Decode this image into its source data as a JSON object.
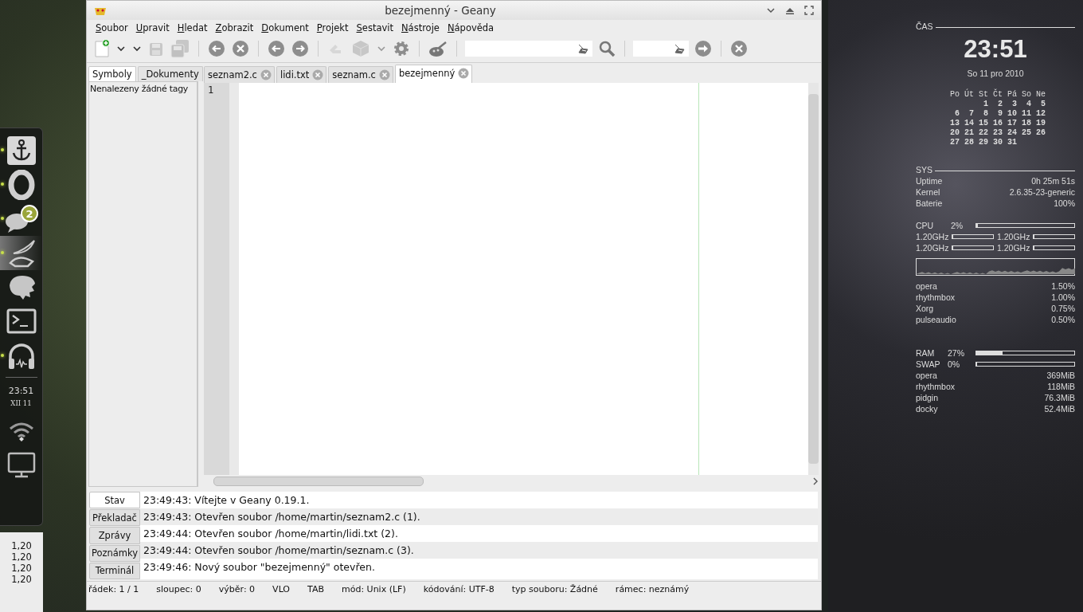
{
  "window": {
    "title": "bezejmenný - Geany"
  },
  "menu": [
    "Soubor",
    "Upravit",
    "Hledat",
    "Zobrazit",
    "Dokument",
    "Projekt",
    "Sestavit",
    "Nástroje",
    "Nápověda"
  ],
  "toolbar": [
    {
      "kind": "new",
      "disabled": false
    },
    {
      "kind": "caret",
      "disabled": false
    },
    {
      "kind": "caret",
      "disabled": false
    },
    {
      "kind": "save",
      "disabled": true
    },
    {
      "kind": "save-all",
      "disabled": true
    },
    {
      "kind": "sep"
    },
    {
      "kind": "revert",
      "disabled": false
    },
    {
      "kind": "close",
      "disabled": false
    },
    {
      "kind": "sep"
    },
    {
      "kind": "back",
      "disabled": false
    },
    {
      "kind": "forward",
      "disabled": false
    },
    {
      "kind": "sep"
    },
    {
      "kind": "compile",
      "disabled": true
    },
    {
      "kind": "build",
      "disabled": true
    },
    {
      "kind": "caret",
      "disabled": true
    },
    {
      "kind": "gear",
      "disabled": false
    },
    {
      "kind": "sep"
    },
    {
      "kind": "palette",
      "disabled": false
    },
    {
      "kind": "sep"
    },
    {
      "kind": "search-field"
    },
    {
      "kind": "search",
      "disabled": false
    },
    {
      "kind": "sep"
    },
    {
      "kind": "line-field"
    },
    {
      "kind": "jump",
      "disabled": false
    },
    {
      "kind": "sep"
    },
    {
      "kind": "quit",
      "disabled": false
    }
  ],
  "sidebar_tabs": [
    {
      "label": "Symboly",
      "selected": true
    },
    {
      "label": "_Dokumenty",
      "selected": false
    }
  ],
  "sidebar": {
    "message": "Nenalezeny žádné tagy"
  },
  "editor_tabs": [
    {
      "label": "seznam2.c",
      "selected": false
    },
    {
      "label": "lidi.txt",
      "selected": false
    },
    {
      "label": "seznam.c",
      "selected": false
    },
    {
      "label": "bezejmenný",
      "selected": true
    }
  ],
  "editor": {
    "line_numbers": [
      "1"
    ]
  },
  "message_tabs": [
    {
      "label": "Stav",
      "selected": true
    },
    {
      "label": "Překladač",
      "selected": false
    },
    {
      "label": "Zprávy",
      "selected": false
    },
    {
      "label": "Poznámky",
      "selected": false
    },
    {
      "label": "Terminál",
      "selected": false
    }
  ],
  "messages": [
    "23:49:43: Vítejte v Geany 0.19.1.",
    "23:49:43: Otevřen soubor /home/martin/seznam2.c (1).",
    "23:49:44: Otevřen soubor /home/martin/lidi.txt (2).",
    "23:49:44: Otevřen soubor /home/martin/seznam.c (3).",
    "23:49:46: Nový soubor \"bezejmenný\" otevřen."
  ],
  "status_bar": [
    "řádek: 1 / 1",
    "sloupec: 0",
    "výběr: 0",
    "VLO",
    "TAB",
    "mód: Unix (LF)",
    "kódování: UTF-8",
    "typ souboru: Žádné",
    "rámec: neznámý"
  ],
  "dock": {
    "items": [
      {
        "kind": "anchor",
        "running": true,
        "selected": false
      },
      {
        "kind": "letter-o",
        "running": true,
        "selected": false
      },
      {
        "kind": "chat",
        "running": true,
        "selected": false,
        "badge": "2"
      },
      {
        "kind": "lamp",
        "running": true,
        "selected": true
      },
      {
        "kind": "blob",
        "running": false,
        "selected": false
      },
      {
        "kind": "terminal",
        "running": false,
        "selected": false
      },
      {
        "kind": "headphones",
        "running": true,
        "selected": false
      }
    ],
    "clock_time": "23:51",
    "clock_date": "XII 11",
    "tray": [
      {
        "kind": "wifi"
      },
      {
        "kind": "monitor"
      }
    ]
  },
  "side_panel": [
    "1,20",
    "1,20",
    "1,20",
    "1,20"
  ],
  "conky": {
    "time_heading": "ČAS",
    "time": "23:51",
    "date": "So 11 pro 2010",
    "calendar": {
      "weekdays": [
        "Po",
        "Út",
        "St",
        "Čt",
        "Pá",
        "So",
        "Ne"
      ],
      "weeks": [
        [
          "1",
          "2",
          "3",
          "4",
          "5"
        ],
        [
          "6",
          "7",
          "8",
          "9",
          "10",
          "11",
          "12"
        ],
        [
          "13",
          "14",
          "15",
          "16",
          "17",
          "18",
          "19"
        ],
        [
          "20",
          "21",
          "22",
          "23",
          "24",
          "25",
          "26"
        ],
        [
          "27",
          "28",
          "29",
          "30",
          "31"
        ]
      ]
    },
    "sys_heading": "SYS",
    "sys": [
      {
        "label": "Uptime",
        "value": "0h 25m 51s"
      },
      {
        "label": "Kernel",
        "value": "2.6.35-23-generic"
      },
      {
        "label": "Baterie",
        "value": "100%"
      }
    ],
    "cpu": {
      "label": "CPU",
      "reading": "2%",
      "level": 0.02
    },
    "cores": [
      {
        "reading": "1.20GHz",
        "level": 0
      },
      {
        "reading": "1.20GHz",
        "level": 0
      },
      {
        "reading": "1.20GHz",
        "level": 0
      },
      {
        "reading": "1.20GHz",
        "level": 0
      }
    ],
    "cpu_processes": [
      {
        "name": "opera",
        "value": "1.50%"
      },
      {
        "name": "rhythmbox",
        "value": "1.00%"
      },
      {
        "name": "Xorg",
        "value": "0.75%"
      },
      {
        "name": "pulseaudio",
        "value": "0.50%"
      }
    ],
    "memory": [
      {
        "label": "RAM",
        "reading": "27%",
        "level": 0.27
      },
      {
        "label": "SWAP",
        "reading": "0%",
        "level": 0
      }
    ],
    "mem_processes": [
      {
        "name": "opera",
        "value": "369MiB"
      },
      {
        "name": "rhythmbox",
        "value": "118MiB"
      },
      {
        "name": "pidgin",
        "value": "76.3MiB"
      },
      {
        "name": "docky",
        "value": "52.4MiB"
      }
    ]
  }
}
